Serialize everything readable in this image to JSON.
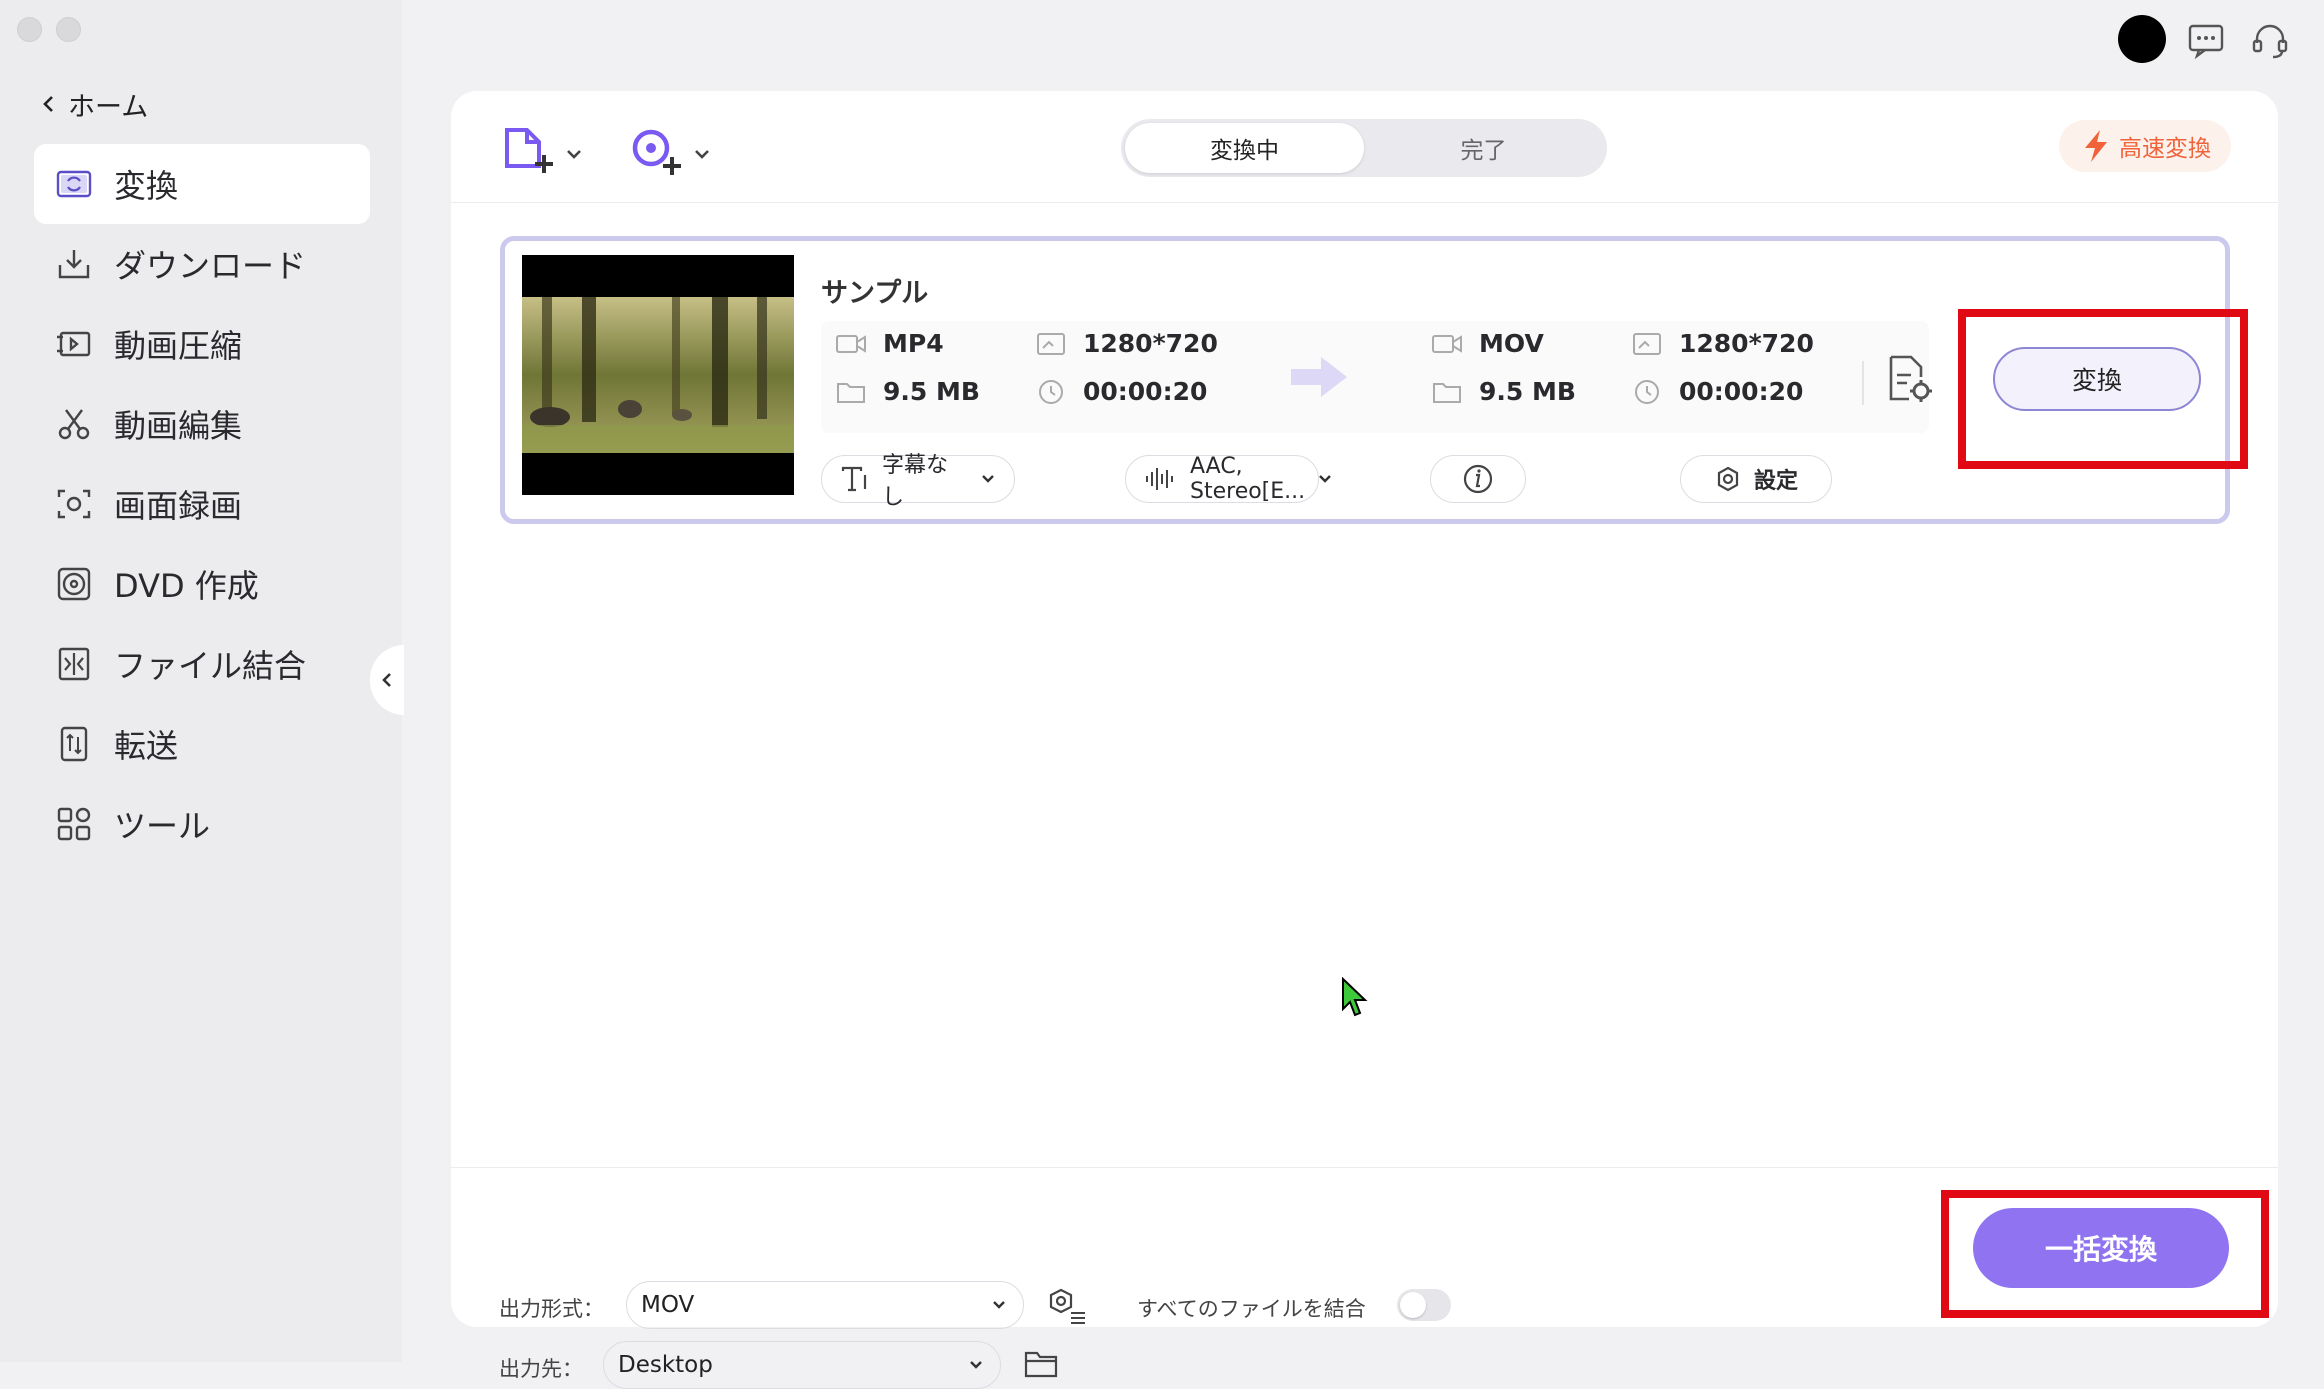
{
  "sidebar": {
    "home_label": "ホーム",
    "items": [
      {
        "label": "変換",
        "icon": "convert-icon"
      },
      {
        "label": "ダウンロード",
        "icon": "download-icon"
      },
      {
        "label": "動画圧縮",
        "icon": "compress-icon"
      },
      {
        "label": "動画編集",
        "icon": "scissors-icon"
      },
      {
        "label": "画面録画",
        "icon": "screen-record-icon"
      },
      {
        "label": "DVD 作成",
        "icon": "dvd-icon"
      },
      {
        "label": "ファイル結合",
        "icon": "merge-icon"
      },
      {
        "label": "転送",
        "icon": "transfer-icon"
      },
      {
        "label": "ツール",
        "icon": "tools-icon"
      }
    ]
  },
  "tabs": {
    "converting": "変換中",
    "finished": "完了"
  },
  "fast_convert_label": "高速変換",
  "file": {
    "name": "サンプル",
    "source": {
      "format": "MP4",
      "resolution": "1280*720",
      "size": "9.5 MB",
      "duration": "00:00:20"
    },
    "target": {
      "format": "MOV",
      "resolution": "1280*720",
      "size": "9.5 MB",
      "duration": "00:00:20"
    },
    "subtitle": "字幕なし",
    "audio": "AAC, Stereo[E...",
    "settings_label": "設定",
    "convert_label": "変換"
  },
  "footer": {
    "output_format_label": "出力形式：",
    "output_format_value": "MOV",
    "merge_label": "すべてのファイルを結合",
    "output_dest_label": "出力先：",
    "output_dest_value": "Desktop",
    "batch_convert_label": "一括変換"
  },
  "colors": {
    "accent": "#8f73f0",
    "highlight": "#e10914",
    "fast_convert": "#f0633a"
  }
}
